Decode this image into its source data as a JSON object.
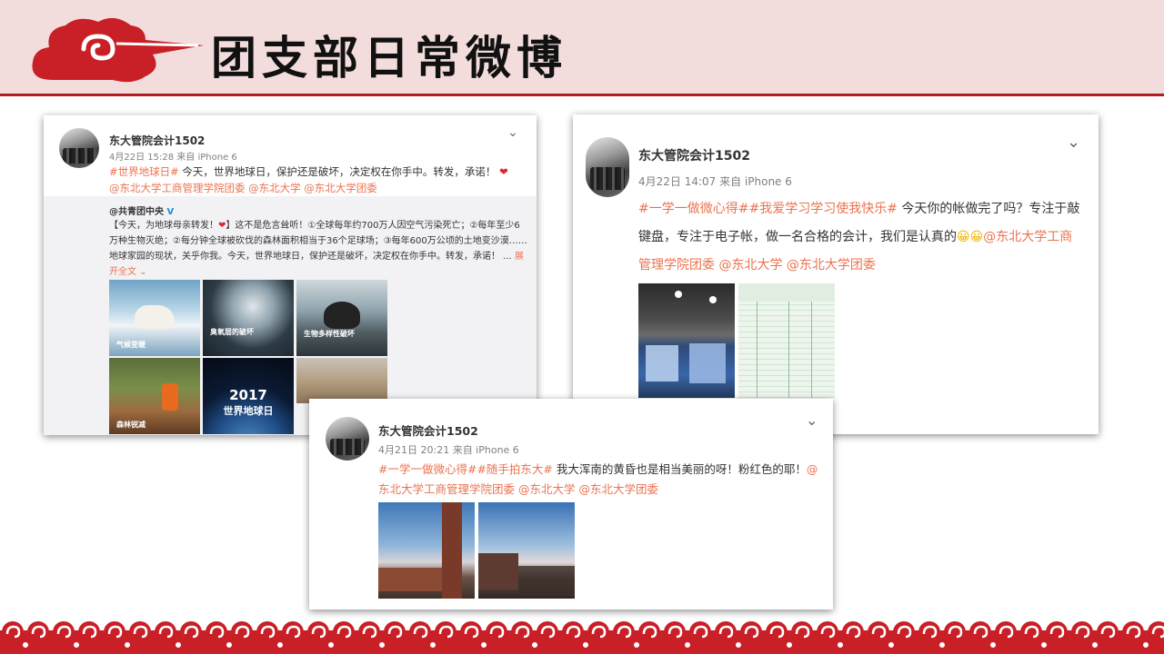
{
  "slide": {
    "title": "团支部日常微博"
  },
  "posts": [
    {
      "username": "东大管院会计1502",
      "meta": "4月22日 15:28 来自 iPhone 6",
      "text_segments": [
        {
          "t": "#世界地球日#",
          "hl": true
        },
        {
          "t": " 今天，世界地球日，保护还是破坏，决定权在你手中。转发，承诺！ ",
          "hl": false
        },
        {
          "t": "❤",
          "heart": true
        },
        {
          "t": "@东北大学工商管理学院团委 @东北大学 @东北大学团委",
          "hl": true
        }
      ],
      "repost": {
        "author": "@共青团中央",
        "verified": "V",
        "text_before": "【今天，为地球母亲转发！",
        "heart": "❤",
        "text_after": "】这不是危言耸听！①全球每年约700万人因空气污染死亡；②每年至少6万种生物灭绝；②每分钟全球被砍伐的森林面积相当于36个足球场；③每年600万公顷的土地变沙漠……地球家园的现状，关乎你我。今天，世界地球日，保护还是破坏，决定权在你手中。转发，承诺！ ... ",
        "more": "展开全文 ⌄",
        "images": [
          {
            "label": "气候变暖",
            "icon": "polar-bear-icon"
          },
          {
            "label": "臭氧层的破坏",
            "icon": "ozone-earth-icon"
          },
          {
            "label": "生物多样性破坏",
            "icon": "seal-icon"
          },
          {
            "label": "森林锐减",
            "icon": "logging-icon"
          },
          {
            "label": "2017",
            "sublabel": "世界地球日",
            "icon": "earth-icon"
          },
          {
            "label": "",
            "icon": "desert-icon"
          }
        ]
      }
    },
    {
      "username": "东大管院会计1502",
      "meta": "4月22日 14:07 来自 iPhone 6",
      "text_segments": [
        {
          "t": "#一学一做微心得##我爱学习学习使我快乐#",
          "hl": true
        },
        {
          "t": " 今天你的帐做完了吗？专注于敲键盘，专注于电子帐，做一名合格的会计，我们是认真的",
          "hl": false
        },
        {
          "t": "😀😀",
          "emoji": true
        },
        {
          "t": "@东北大学工商管理学院团委 @东北大学 @东北大学团委",
          "hl": true
        }
      ],
      "images": [
        "computer-lab-photo",
        "spreadsheet-photo"
      ]
    },
    {
      "username": "东大管院会计1502",
      "meta": "4月21日 20:21 来自 iPhone 6",
      "text_segments": [
        {
          "t": "#一学一做微心得##随手拍东大#",
          "hl": true
        },
        {
          "t": " 我大浑南的黄昏也是相当美丽的呀！粉红色的耶！",
          "hl": false
        },
        {
          "t": "@东北大学工商管理学院团委 @东北大学 @东北大学团委",
          "hl": true
        }
      ],
      "images": [
        "campus-sunset-photo-1",
        "campus-sunset-photo-2"
      ]
    }
  ],
  "colors": {
    "accent": "#b11d22",
    "header_bg": "#f3dcdc",
    "link": "#eb7350"
  }
}
